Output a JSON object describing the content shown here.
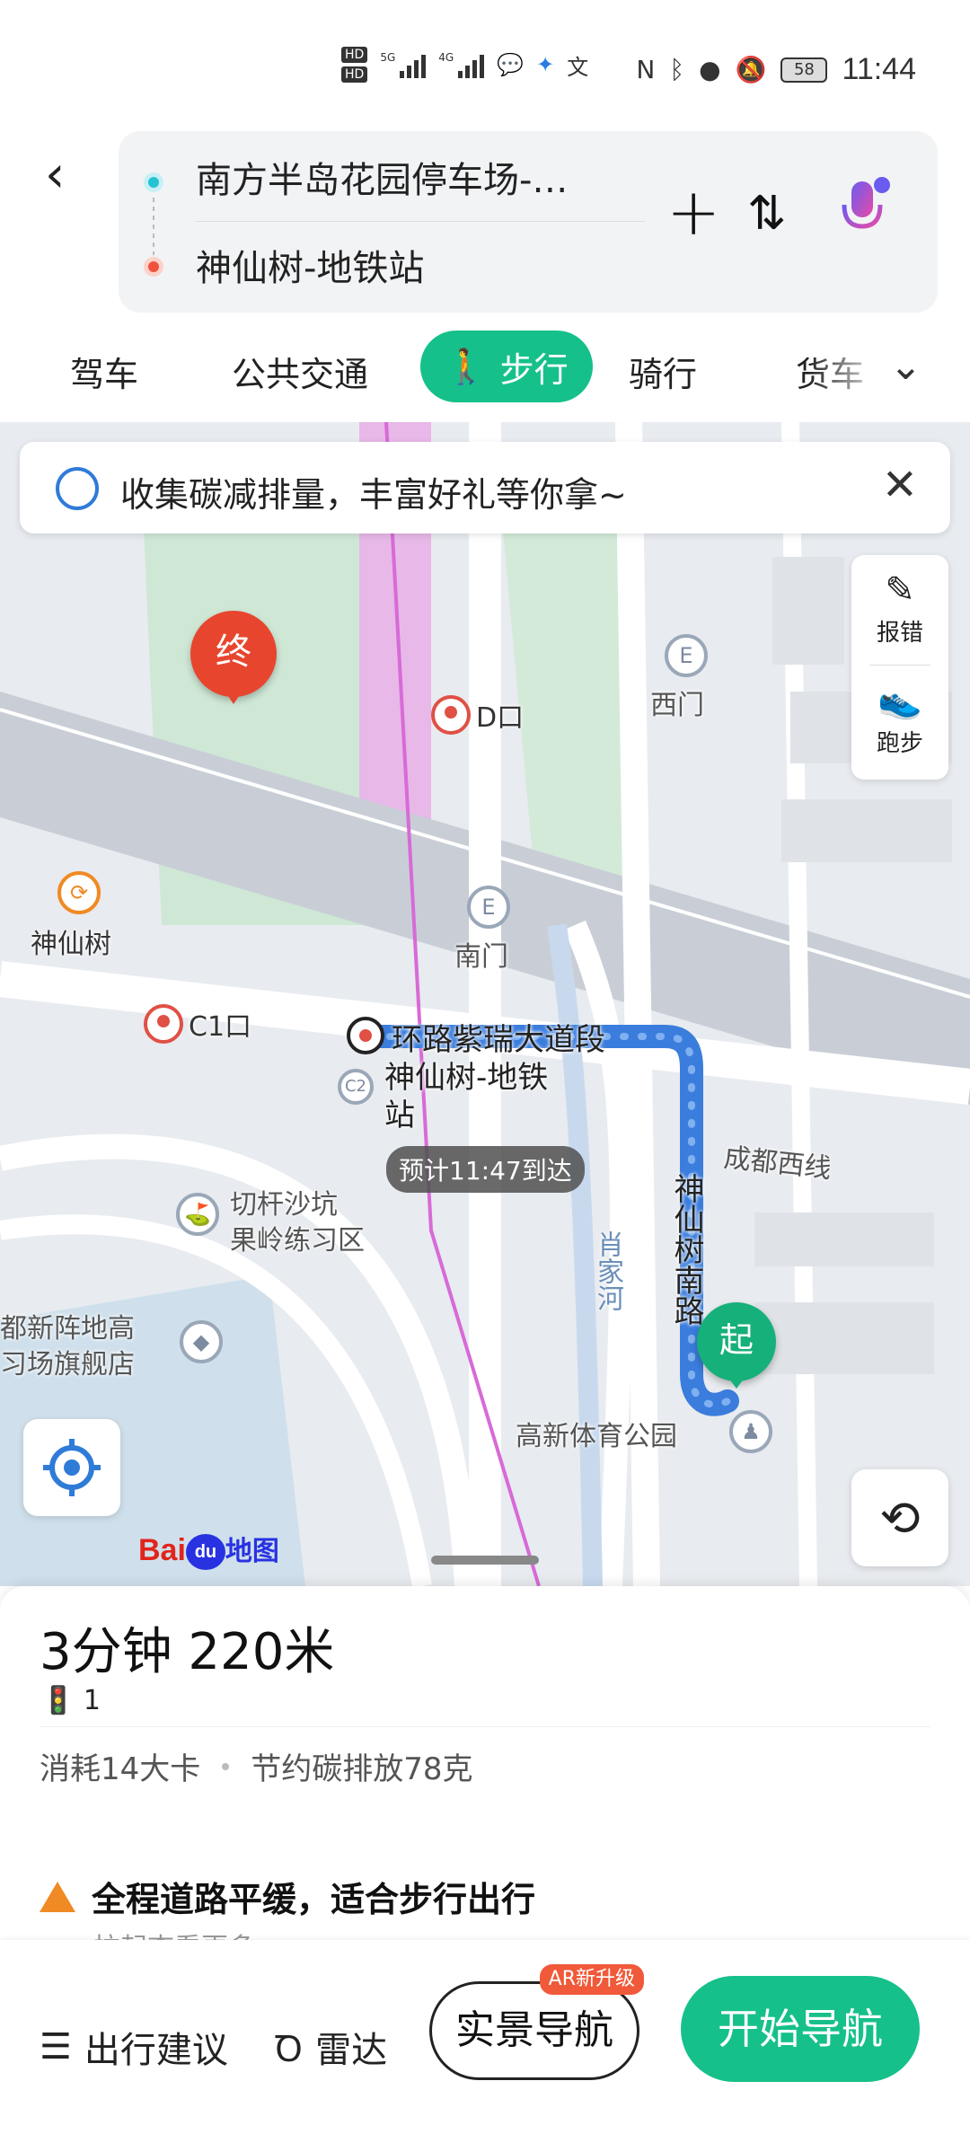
{
  "status_bar": {
    "time": "11:44",
    "battery": "58",
    "network_5g": "5G",
    "network_4g": "4G",
    "sim_labels": [
      "HD",
      "HD"
    ]
  },
  "route_search": {
    "from": "南方半岛花园停车场-…",
    "to": "神仙树-地铁站"
  },
  "modes": {
    "drive": "驾车",
    "transit": "公共交通",
    "walk": "步行",
    "cycle": "骑行",
    "truck": "货车"
  },
  "banner": {
    "text": "收集碳减排量，丰富好礼等你拿~"
  },
  "side_tools": {
    "report": "报错",
    "run": "跑步"
  },
  "map_labels": {
    "end_marker": "终",
    "start_marker": "起",
    "exit_d": "D口",
    "exit_c1": "C1口",
    "west_gate": "西门",
    "south_gate": "南门",
    "shenxianshu": "神仙树",
    "station_road": "环路紫瑞大道段",
    "station_name_1": "神仙树-地铁",
    "station_name_2": "站",
    "eta": "预计11:47到达",
    "chengdu_west": "成都西线",
    "road_vertical": "神仙树南路",
    "river": "肖家河",
    "practice_1": "切杆沙坑",
    "practice_2": "果岭练习区",
    "store_1": "都新阵地高",
    "store_2": "习场旗舰店",
    "park": "高新体育公园",
    "c2": "C2",
    "logo_bai": "Bai",
    "logo_du": "du",
    "logo_map": "地图"
  },
  "summary": {
    "duration_distance": "3分钟  220米",
    "traffic_lights": "1",
    "calories": "消耗14大卡",
    "carbon": "节约碳排放78克",
    "tip_title": "全程道路平缓，适合步行出行",
    "tip_sub": "拉起查看更多"
  },
  "bottom_bar": {
    "suggestion": "出行建议",
    "radar": "雷达",
    "ar_nav": "实景导航",
    "ar_badge": "AR新升级",
    "start_nav": "开始导航"
  },
  "colors": {
    "accent_green": "#16c08a",
    "route_blue": "#3b7ddd",
    "end_red": "#e8452e"
  }
}
